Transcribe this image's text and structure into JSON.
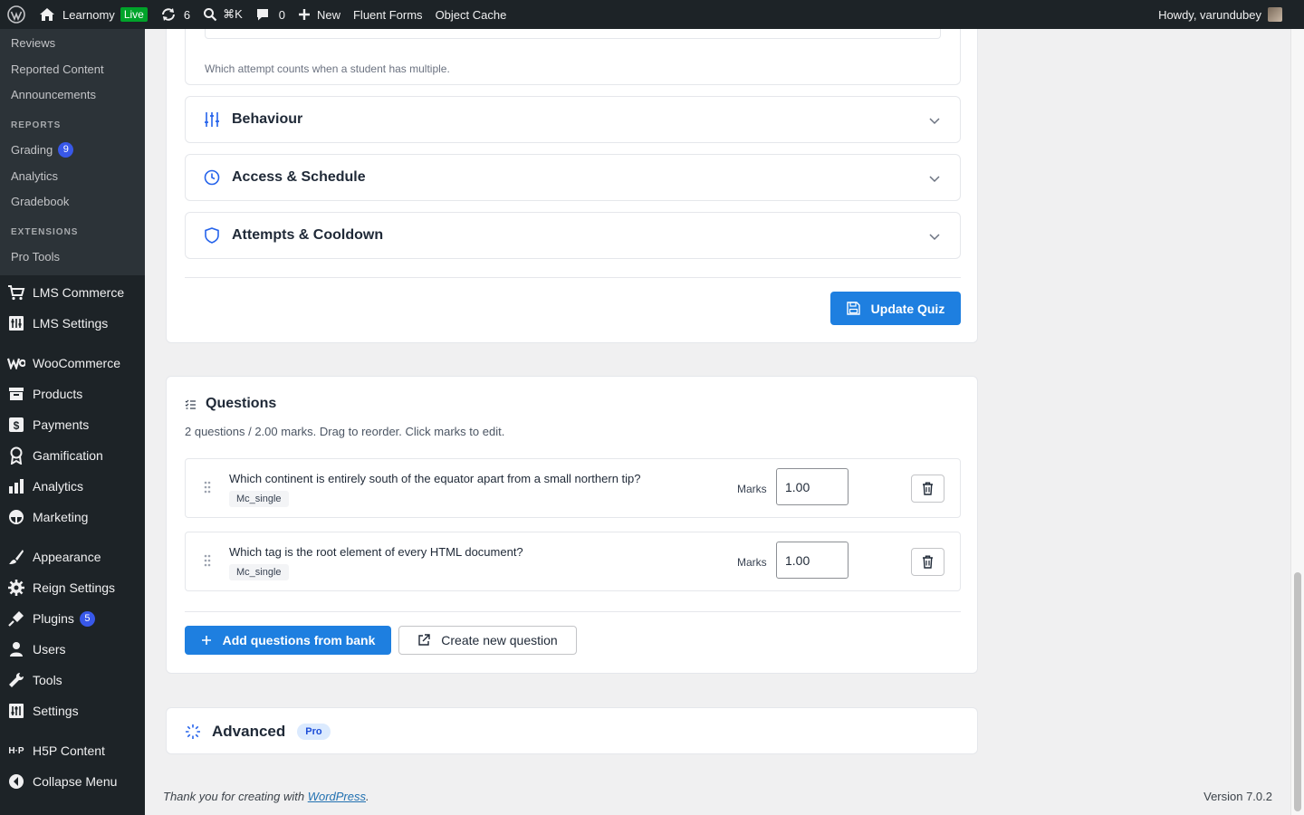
{
  "adminbar": {
    "site_name": "Learnomy",
    "live_label": "Live",
    "updates_count": "6",
    "search_shortcut": "⌘K",
    "comments_count": "0",
    "new_label": "New",
    "fluent_forms": "Fluent Forms",
    "object_cache": "Object Cache",
    "howdy": "Howdy, varundubey"
  },
  "sidebar": {
    "sub_top": [
      "Reviews",
      "Reported Content",
      "Announcements"
    ],
    "reports_head": "REPORTS",
    "reports": [
      {
        "label": "Grading",
        "badge": "9"
      },
      {
        "label": "Analytics"
      },
      {
        "label": "Gradebook"
      }
    ],
    "extensions_head": "EXTENSIONS",
    "extensions": [
      "Pro Tools"
    ],
    "menu": [
      {
        "label": "LMS Commerce",
        "icon": "cart-icon"
      },
      {
        "label": "LMS Settings",
        "icon": "settings-grid-icon"
      },
      {
        "label": "WooCommerce",
        "icon": "woo-icon"
      },
      {
        "label": "Products",
        "icon": "archive-icon"
      },
      {
        "label": "Payments",
        "icon": "dollar-icon"
      },
      {
        "label": "Gamification",
        "icon": "award-icon"
      },
      {
        "label": "Analytics",
        "icon": "bar-chart-icon"
      },
      {
        "label": "Marketing",
        "icon": "megaphone-icon"
      },
      {
        "label": "Appearance",
        "icon": "brush-icon"
      },
      {
        "label": "Reign Settings",
        "icon": "gear-icon"
      },
      {
        "label": "Plugins",
        "icon": "plugin-icon",
        "badge": "5"
      },
      {
        "label": "Users",
        "icon": "user-icon"
      },
      {
        "label": "Tools",
        "icon": "wrench-icon"
      },
      {
        "label": "Settings",
        "icon": "sliders-icon"
      },
      {
        "label": "H5P Content",
        "icon": "h5p-icon"
      },
      {
        "label": "Collapse Menu",
        "icon": "collapse-icon"
      }
    ]
  },
  "quiz_settings": {
    "help_text": "Which attempt counts when a student has multiple.",
    "sections": [
      "Behaviour",
      "Access & Schedule",
      "Attempts & Cooldown"
    ],
    "update_button": "Update Quiz"
  },
  "questions": {
    "title": "Questions",
    "summary": "2 questions / 2.00 marks. Drag to reorder. Click marks to edit.",
    "marks_label": "Marks",
    "items": [
      {
        "text": "Which continent is entirely south of the equator apart from a small northern tip?",
        "type": "Mc_single",
        "marks": "1.00"
      },
      {
        "text": "Which tag is the root element of every HTML document?",
        "type": "Mc_single",
        "marks": "1.00"
      }
    ],
    "add_from_bank": "Add questions from bank",
    "create_new": "Create new question"
  },
  "advanced": {
    "title": "Advanced",
    "badge": "Pro"
  },
  "footer": {
    "thanks_prefix": "Thank you for creating with",
    "thanks_link": "WordPress",
    "thanks_suffix": ".",
    "version": "Version 7.0.2"
  },
  "colors": {
    "admin_dark": "#1d2327",
    "primary": "#1e7fe0",
    "live_green": "#00a32a",
    "badge_blue": "#3858e9"
  }
}
